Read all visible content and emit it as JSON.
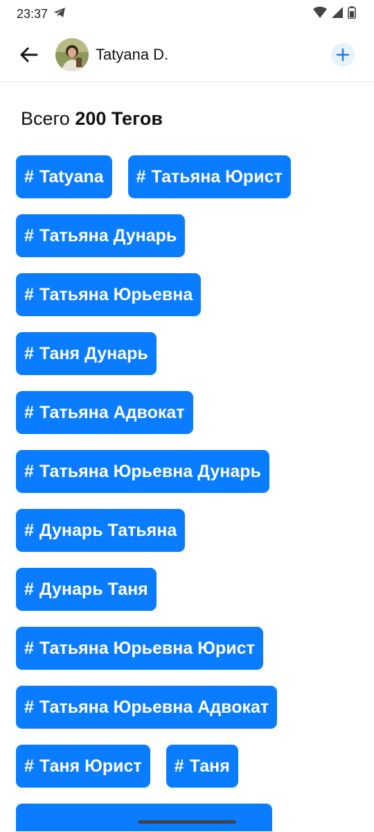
{
  "status": {
    "time": "23:37"
  },
  "header": {
    "name": "Tatyana D."
  },
  "summary": {
    "prefix": "Всего",
    "count": "200 Тегов"
  },
  "tags": [
    [
      "Tatyana",
      "Татьяна Юрист"
    ],
    [
      "Татьяна Дунарь"
    ],
    [
      "Татьяна Юрьевна"
    ],
    [
      "Таня Дунарь"
    ],
    [
      "Татьяна Адвокат"
    ],
    [
      "Татьяна Юрьевна Дунарь"
    ],
    [
      "Дунарь Татьяна"
    ],
    [
      "Дунарь Таня"
    ],
    [
      "Татьяна Юрьевна Юрист"
    ],
    [
      "Татьяна Юрьевна Адвокат"
    ],
    [
      "Таня Юрист",
      "Таня"
    ]
  ],
  "colors": {
    "accent": "#0a7cff",
    "add_button_bg": "#e9f1fb"
  }
}
